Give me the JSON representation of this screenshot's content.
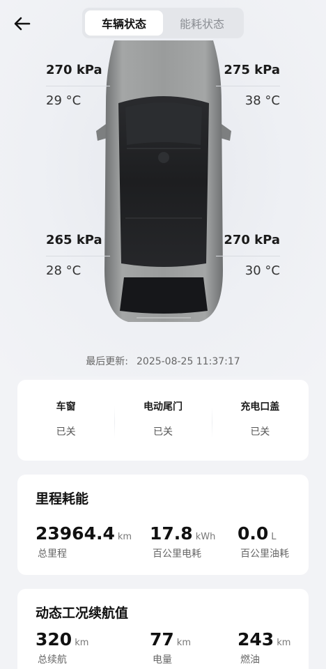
{
  "tabs": [
    {
      "label": "车辆状态",
      "active": true
    },
    {
      "label": "能耗状态",
      "active": false
    }
  ],
  "tires": {
    "front_left": {
      "pressure": "270 kPa",
      "temp": "29 °C"
    },
    "front_right": {
      "pressure": "275 kPa",
      "temp": "38 °C"
    },
    "rear_left": {
      "pressure": "265 kPa",
      "temp": "28 °C"
    },
    "rear_right": {
      "pressure": "270 kPa",
      "temp": "30 °C"
    }
  },
  "update": {
    "label": "最后更新:",
    "time": "2025-08-25 11:37:17"
  },
  "status": [
    {
      "label": "车窗",
      "value": "已关"
    },
    {
      "label": "电动尾门",
      "value": "已关"
    },
    {
      "label": "充电口盖",
      "value": "已关"
    }
  ],
  "mileage": {
    "title": "里程耗能",
    "metrics": [
      {
        "value": "23964.4",
        "unit": "km",
        "caption": "总里程"
      },
      {
        "value": "17.8",
        "unit": "kWh",
        "caption": "百公里电耗"
      },
      {
        "value": "0.0",
        "unit": "L",
        "caption": "百公里油耗"
      }
    ]
  },
  "range": {
    "title": "动态工况续航值",
    "metrics": [
      {
        "value": "320",
        "unit": "km",
        "caption": "总续航"
      },
      {
        "value": "77",
        "unit": "km",
        "caption": "电量"
      },
      {
        "value": "243",
        "unit": "km",
        "caption": "燃油"
      }
    ]
  },
  "colors": {
    "background": "#f2f3f6",
    "card": "#ffffff",
    "car_body": "#8d8f8f",
    "roof": "#1e1f21"
  },
  "icons": {
    "back": "arrow-left-icon"
  }
}
